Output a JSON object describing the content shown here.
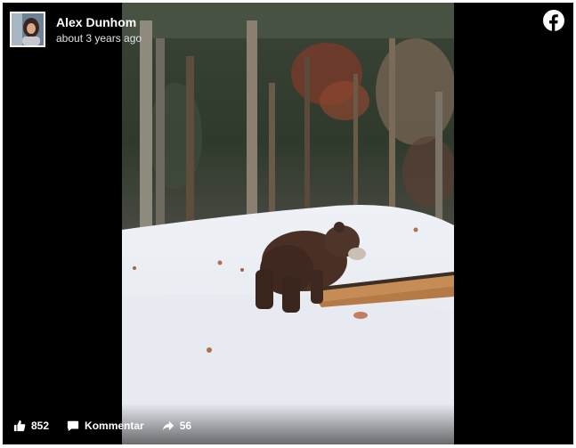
{
  "post": {
    "author": "Alex Dunhom",
    "timestamp": "about 3 years ago"
  },
  "actions": {
    "likes": "852",
    "comment_label": "Kommentar",
    "shares": "56"
  },
  "icons": {
    "brand": "facebook-icon",
    "like": "thumbs-up-icon",
    "comment": "comment-icon",
    "share": "share-arrow-icon"
  },
  "colors": {
    "player_bg": "#000000",
    "text": "#ffffff"
  }
}
